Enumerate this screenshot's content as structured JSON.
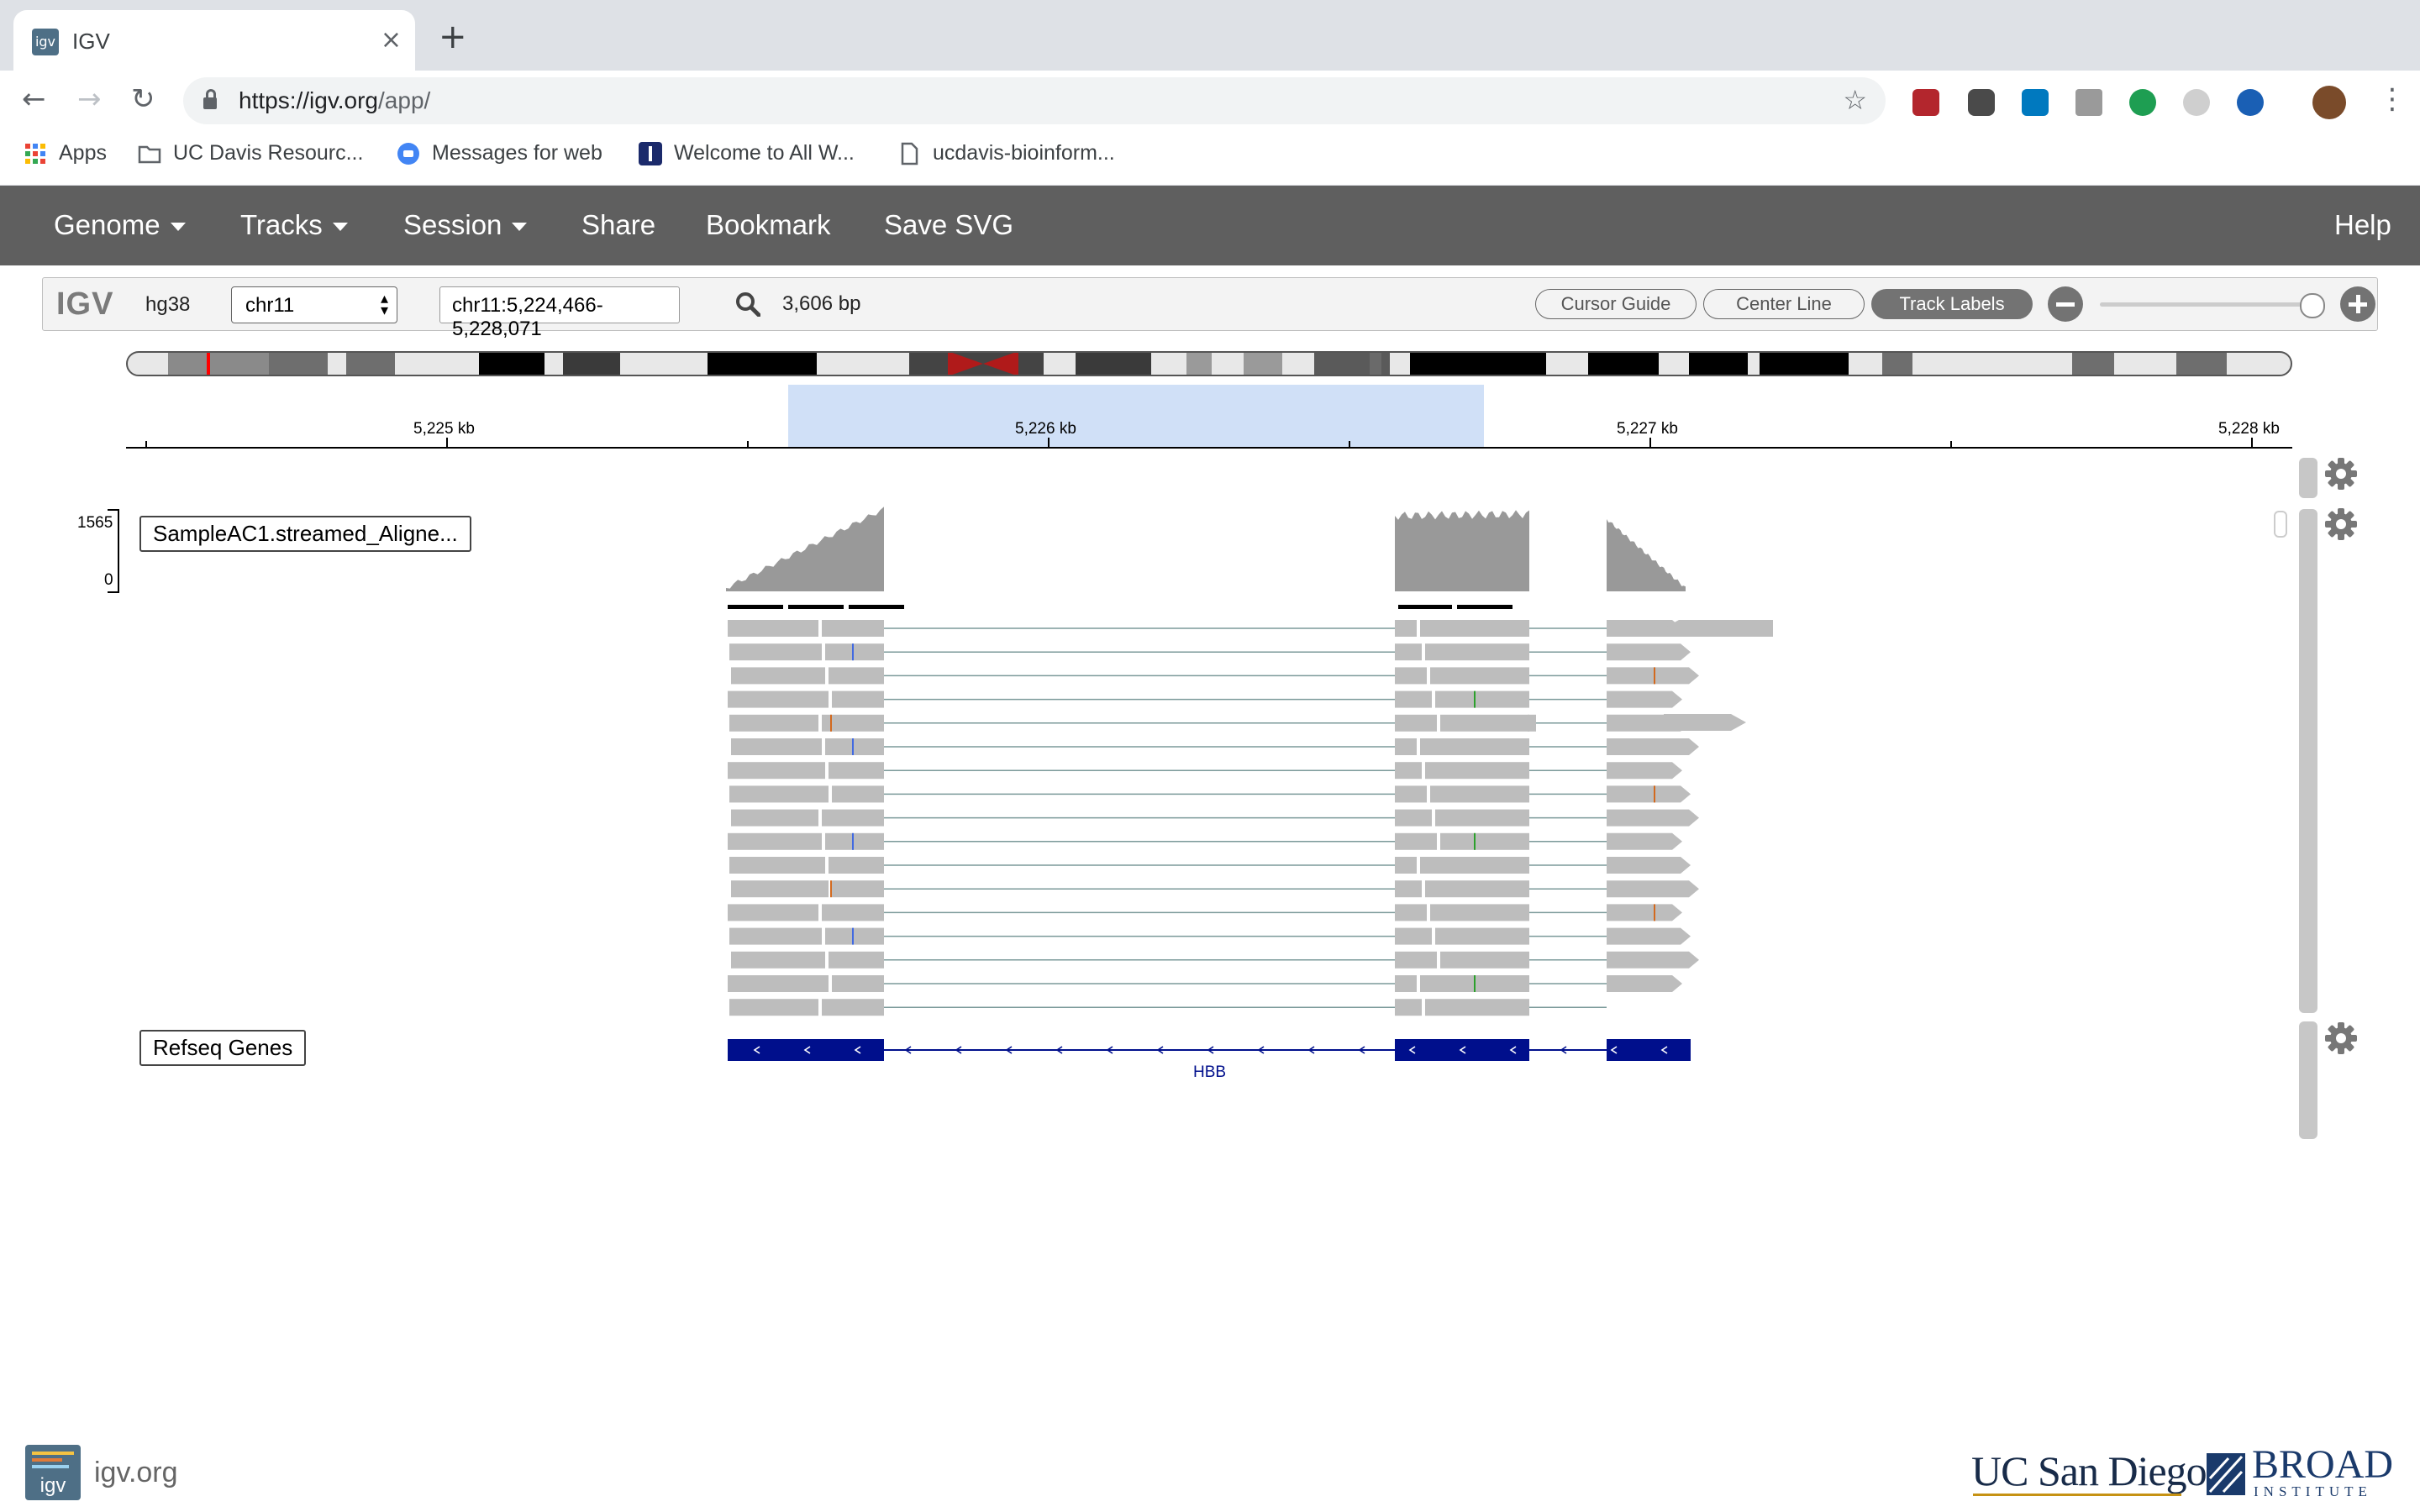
{
  "browser": {
    "tab_title": "IGV",
    "tab_favicon_text": "igv",
    "tab_close": "×",
    "new_tab": "+",
    "url_host": "https://igv.org",
    "url_path": "/app/",
    "star": "☆",
    "menu": "⋮",
    "back": "←",
    "forward": "→",
    "reload": "↻"
  },
  "bookmarks": [
    {
      "label": "Apps",
      "icon": "apps-grid-icon"
    },
    {
      "label": "UC Davis Resourc...",
      "icon": "folder-icon"
    },
    {
      "label": "Messages for web",
      "icon": "messages-icon"
    },
    {
      "label": "Welcome to All W...",
      "icon": "site-icon"
    },
    {
      "label": "ucdavis-bioinform...",
      "icon": "page-icon"
    }
  ],
  "igv_menu": {
    "genome": "Genome",
    "tracks": "Tracks",
    "session": "Session",
    "share": "Share",
    "bookmark": "Bookmark",
    "save_svg": "Save SVG",
    "help": "Help"
  },
  "igv_bar": {
    "logo": "IGV",
    "genome": "hg38",
    "chromosome": "chr11",
    "locus": "chr11:5,224,466-5,228,071",
    "span": "3,606 bp",
    "cursor_guide": "Cursor Guide",
    "center_line": "Center Line",
    "track_labels": "Track Labels"
  },
  "ruler": {
    "ticks": [
      "5,225 kb",
      "5,226 kb",
      "5,227 kb",
      "5,228 kb"
    ]
  },
  "tracks": {
    "alignment_label": "SampleAC1.streamed_Aligne...",
    "coverage_max": "1565",
    "coverage_min": "0",
    "genes_label": "Refseq Genes",
    "gene_name": "HBB"
  },
  "footer": {
    "site": "igv.org",
    "ucsd": "UC San Diego",
    "broad": "BROAD",
    "broad_sub": "INSTITUTE"
  },
  "colors": {
    "nav_bg": "#5f5f5f",
    "read": "#bdbdbd",
    "coverage": "#999999",
    "gene": "#000f8c",
    "roi": "#c8daf6"
  }
}
